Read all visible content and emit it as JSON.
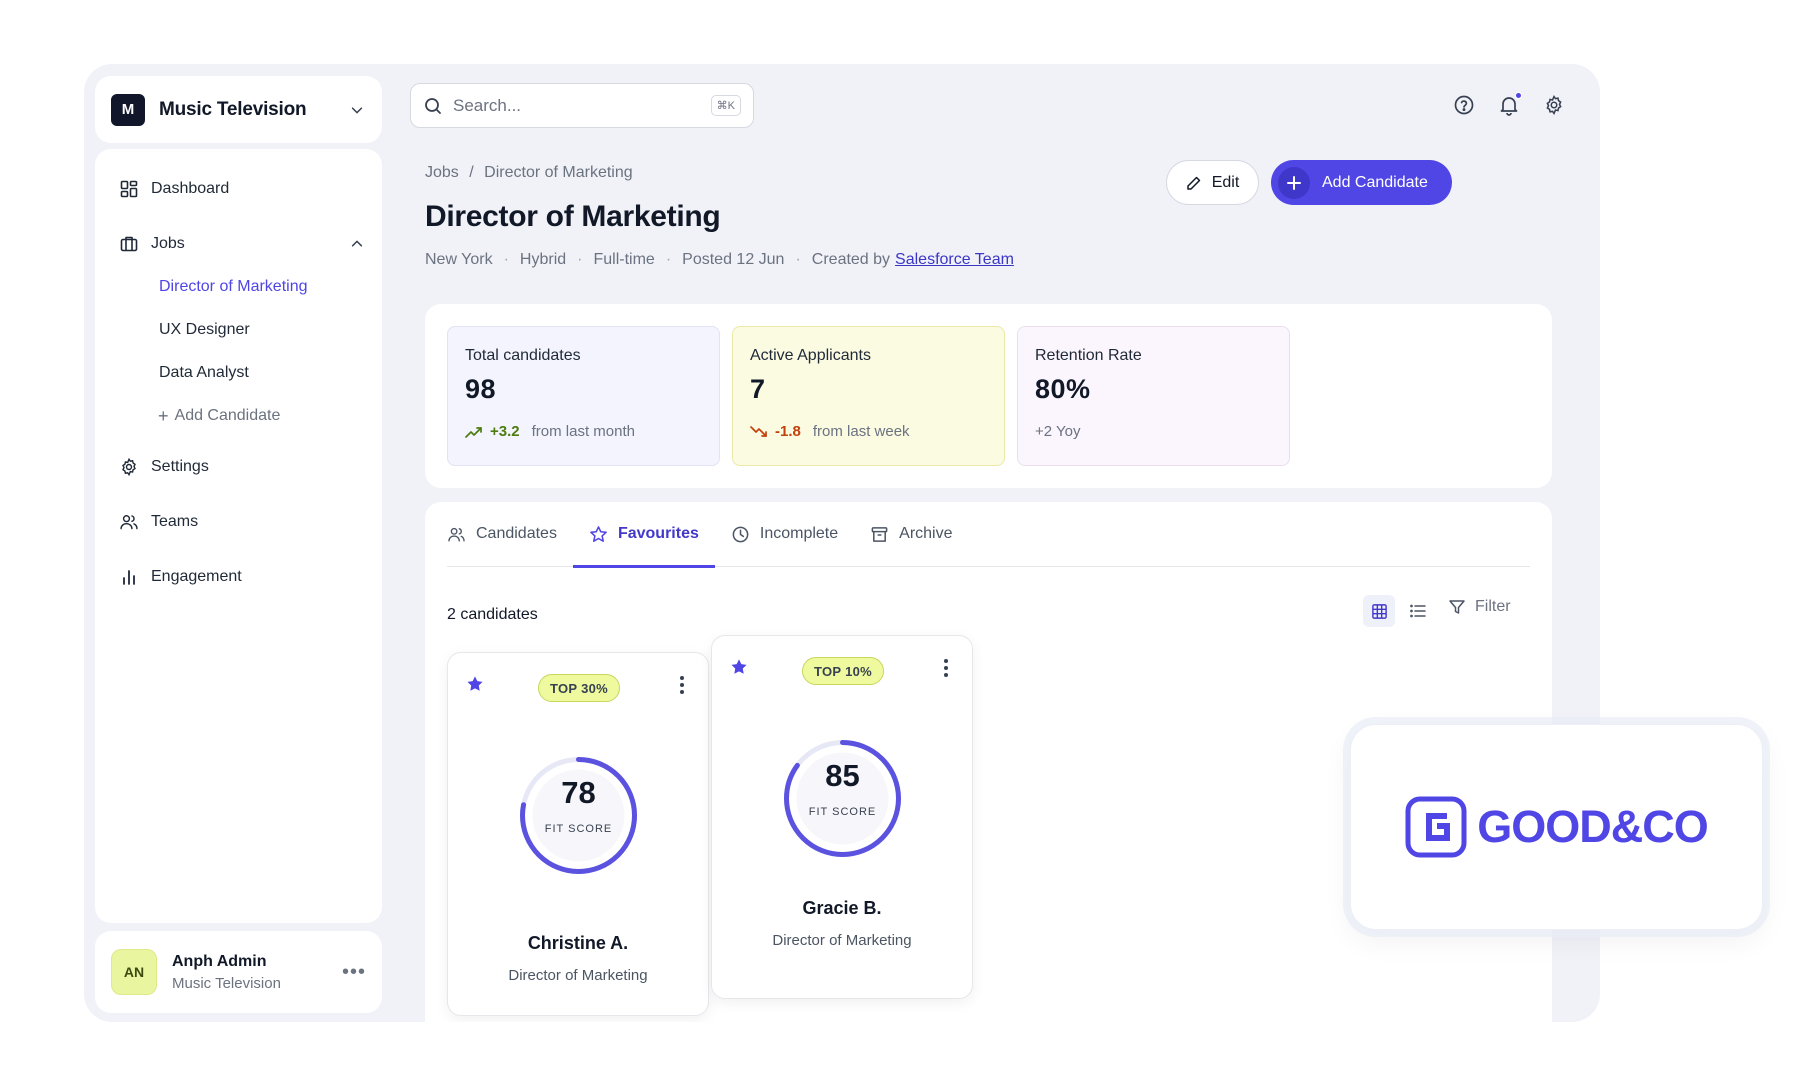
{
  "org": {
    "initial": "M",
    "name": "Music Television"
  },
  "nav": {
    "dashboard": "Dashboard",
    "jobs": "Jobs",
    "jobs_children": [
      "Director of Marketing",
      "UX Designer",
      "Data Analyst"
    ],
    "add_candidate": "Add Candidate",
    "settings": "Settings",
    "teams": "Teams",
    "engagement": "Engagement"
  },
  "user": {
    "initials": "AN",
    "name": "Anph Admin",
    "org": "Music Television"
  },
  "search": {
    "placeholder": "Search...",
    "shortcut": "⌘K"
  },
  "breadcrumb": {
    "root": "Jobs",
    "separator": "/",
    "current": "Director of Marketing"
  },
  "job": {
    "title": "Director of Marketing",
    "location": "New York",
    "mode": "Hybrid",
    "type": "Full-time",
    "posted": "Posted 12 Jun",
    "created_by_label": "Created by",
    "created_by": "Salesforce Team"
  },
  "actions": {
    "edit": "Edit",
    "add_candidate": "Add Candidate"
  },
  "stats": [
    {
      "label": "Total candidates",
      "value": "98",
      "delta": "+3.2",
      "delta_text": "from last month",
      "trend": "up"
    },
    {
      "label": "Active Applicants",
      "value": "7",
      "delta": "-1.8",
      "delta_text": "from last week",
      "trend": "down"
    },
    {
      "label": "Retention Rate",
      "value": "80%",
      "delta_text": "+2 Yoy"
    }
  ],
  "tabs": [
    "Candidates",
    "Favourites",
    "Incomplete",
    "Archive"
  ],
  "active_tab": "Favourites",
  "candidate_count": "2 candidates",
  "filter_label": "Filter",
  "candidates": [
    {
      "badge": "TOP 30%",
      "score": "78",
      "score_value": 78,
      "score_label": "FIT SCORE",
      "name": "Christine A.",
      "role": "Director of Marketing",
      "favourite": true
    },
    {
      "badge": "TOP 10%",
      "score": "85",
      "score_value": 85,
      "score_label": "FIT SCORE",
      "name": "Gracie B.",
      "role": "Director of Marketing",
      "favourite": true
    }
  ],
  "brand": {
    "name": "GOOD&CO",
    "letter": "G"
  },
  "colors": {
    "accent": "#4f46e5",
    "badge": "#eefa9d",
    "positive": "#4d7c0f",
    "negative": "#c2410c"
  }
}
